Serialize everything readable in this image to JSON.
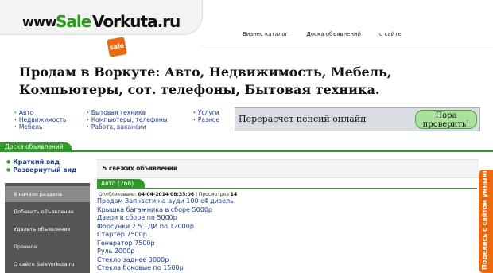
{
  "header": {
    "logo": {
      "www": "www.",
      "sale": "Sale",
      "vorkuta": "Vorkuta.ru",
      "badge": "sale"
    },
    "nav": [
      "Бизнес каталог",
      "Доска объявлений",
      "о сайте"
    ]
  },
  "title": "Продам в Воркуте: Авто, Недвижимость, Мебель, Компьютеры, сот. телефоны, Бытовая техника.",
  "categories": {
    "col1": [
      "Авто",
      "Недвижимость",
      "Мебель"
    ],
    "col2": [
      "Бытовая техника",
      "Компьютеры, телефоны",
      "Работа, вакансии"
    ],
    "col3": [
      "Услуги",
      "Разное"
    ]
  },
  "banner": {
    "text": "Перерасчет пенсий онлайн",
    "button": "Пора проверить!"
  },
  "section_tab": "Доска объявлений",
  "view_links": [
    "Краткий вид",
    "Развернутый вид"
  ],
  "sidebar": {
    "items": [
      "В начало раздела",
      "Добавить объявление",
      "Удалить объявление",
      "Правила",
      "О сайте SaleVorkuta.ru"
    ]
  },
  "fresh_heading": "5 свежих объявлений",
  "auto_tab": "Авто (768)",
  "published": {
    "label": "Опубликовано:",
    "date": "04-04-2014 08:35:06",
    "views_label": "| Просмотров",
    "views": "14"
  },
  "ads": [
    "Продам Запчасти на ауди 100 с4 дизель",
    "Крышка багажника в сборе 5000р",
    "Двери в сборе по 5000р",
    "Форсунки 2.5 ТДИ по 12000р",
    "Стартер 7500р",
    "Генератор 7500р",
    "Руль 2000р",
    "Стекло заднее 3000р",
    "Стекла боковые по 1500р"
  ],
  "side_widget": "Поделись с сайтом умными мыслями :)",
  "colors": {
    "accent_green": "#2f9a27",
    "logo_orange": "#ea6a10",
    "link_blue": "#1a3c8a"
  }
}
